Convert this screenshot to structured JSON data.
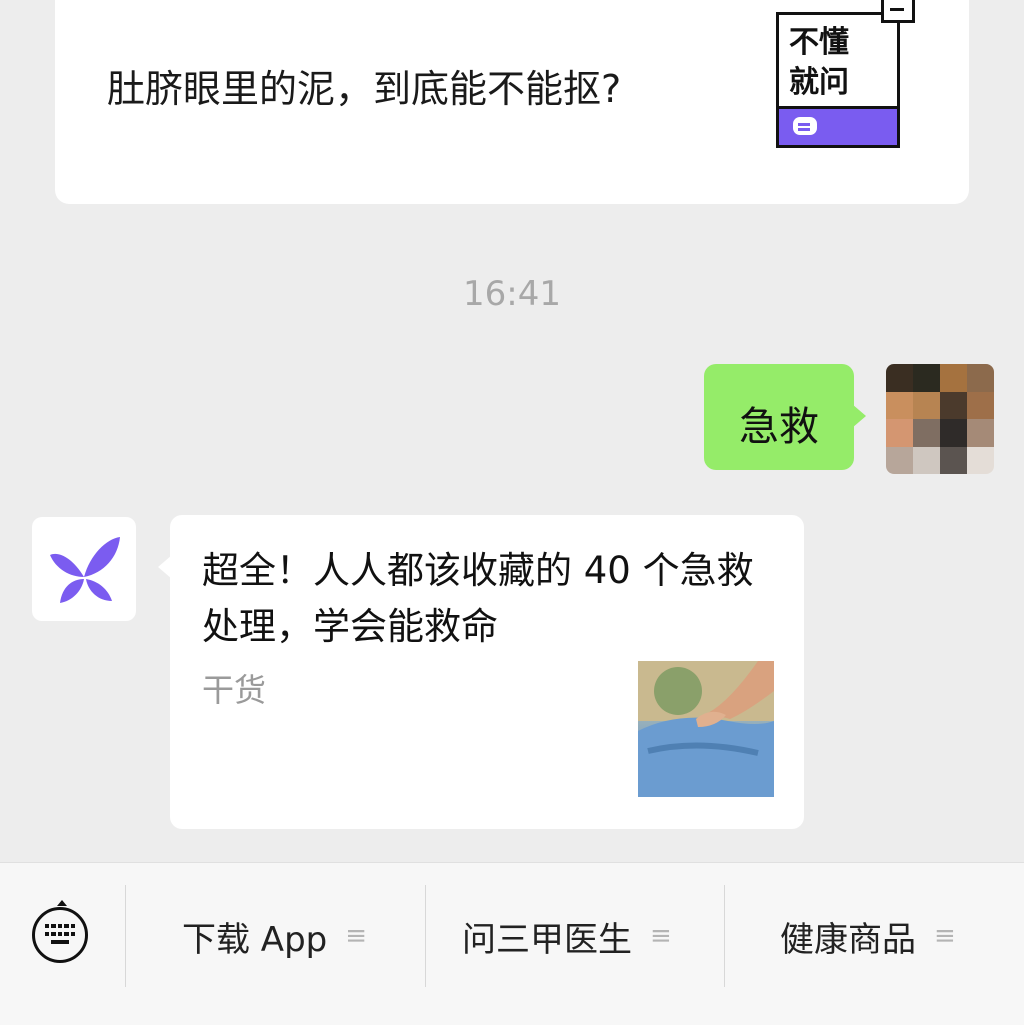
{
  "top_card": {
    "title": "肚脐眼里的泥，到底能不能抠?",
    "badge_text": "不懂\n就问"
  },
  "timestamp": "16:41",
  "outgoing_message": {
    "text": "急救",
    "bubble_color": "#95ec69"
  },
  "link_card": {
    "title": "超全！人人都该收藏的 40 个急救处理，学会能救命",
    "tag": "干货",
    "thumbnail_icon": "cpr-photo"
  },
  "menu_bar": {
    "keyboard_icon": "keyboard-icon",
    "items": [
      {
        "label": "下载 App",
        "icon": "menu-lines-icon"
      },
      {
        "label": "问三甲医生",
        "icon": "menu-lines-icon"
      },
      {
        "label": "健康商品",
        "icon": "menu-lines-icon"
      }
    ],
    "menu_icon_glyph": "≡"
  },
  "colors": {
    "background": "#ededed",
    "accent_purple": "#7a5cf0"
  }
}
